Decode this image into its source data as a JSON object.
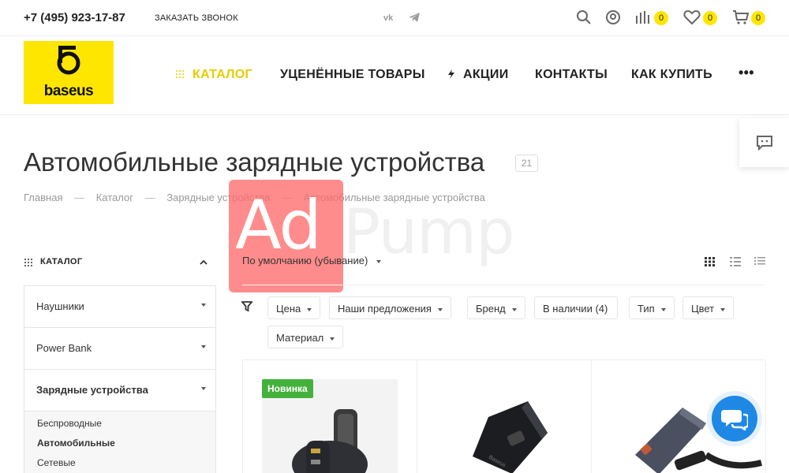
{
  "topbar": {
    "phone": "+7 (495) 923-17-87",
    "callback": "ЗАКАЗАТЬ ЗВОНОК",
    "social": [
      "vk-icon",
      "telegram-icon"
    ],
    "compare_count": "0",
    "wishlist_count": "0",
    "cart_count": "0"
  },
  "header": {
    "logo_text": "baseus",
    "nav": {
      "catalog": "КАТАЛОГ",
      "discount": "УЦЕНЁННЫЕ ТОВАРЫ",
      "actions": "АКЦИИ",
      "contacts": "КОНТАКТЫ",
      "howto": "КАК КУПИТЬ",
      "more": "•••"
    }
  },
  "page": {
    "title": "Автомобильные зарядные устройства",
    "count": "21"
  },
  "breadcrumb": {
    "items": [
      "Главная",
      "Каталог",
      "Зарядные устройства",
      "Автомобильные зарядные устройства"
    ],
    "separator": "—"
  },
  "watermark": {
    "ad": "Ad",
    "pump": "Pump"
  },
  "sidebar": {
    "heading": "КАТАЛОГ",
    "items": [
      "Наушники",
      "Power Bank",
      "Зарядные устройства"
    ],
    "subitems": [
      "Беспроводные",
      "Автомобильные",
      "Сетевые"
    ]
  },
  "sort": {
    "label": "По умолчанию (убывание)"
  },
  "filters": [
    "Цена",
    "Наши предложения",
    "Бренд",
    "В наличии (4)",
    "Тип",
    "Цвет",
    "Материал"
  ],
  "products": {
    "new_badge": "Новинка"
  },
  "colors": {
    "accent": "#ffe600",
    "nav_active": "#e8cc00",
    "new_badge": "#44b13d",
    "chat": "#1e88e5",
    "watermark": "#ff6b6b"
  }
}
